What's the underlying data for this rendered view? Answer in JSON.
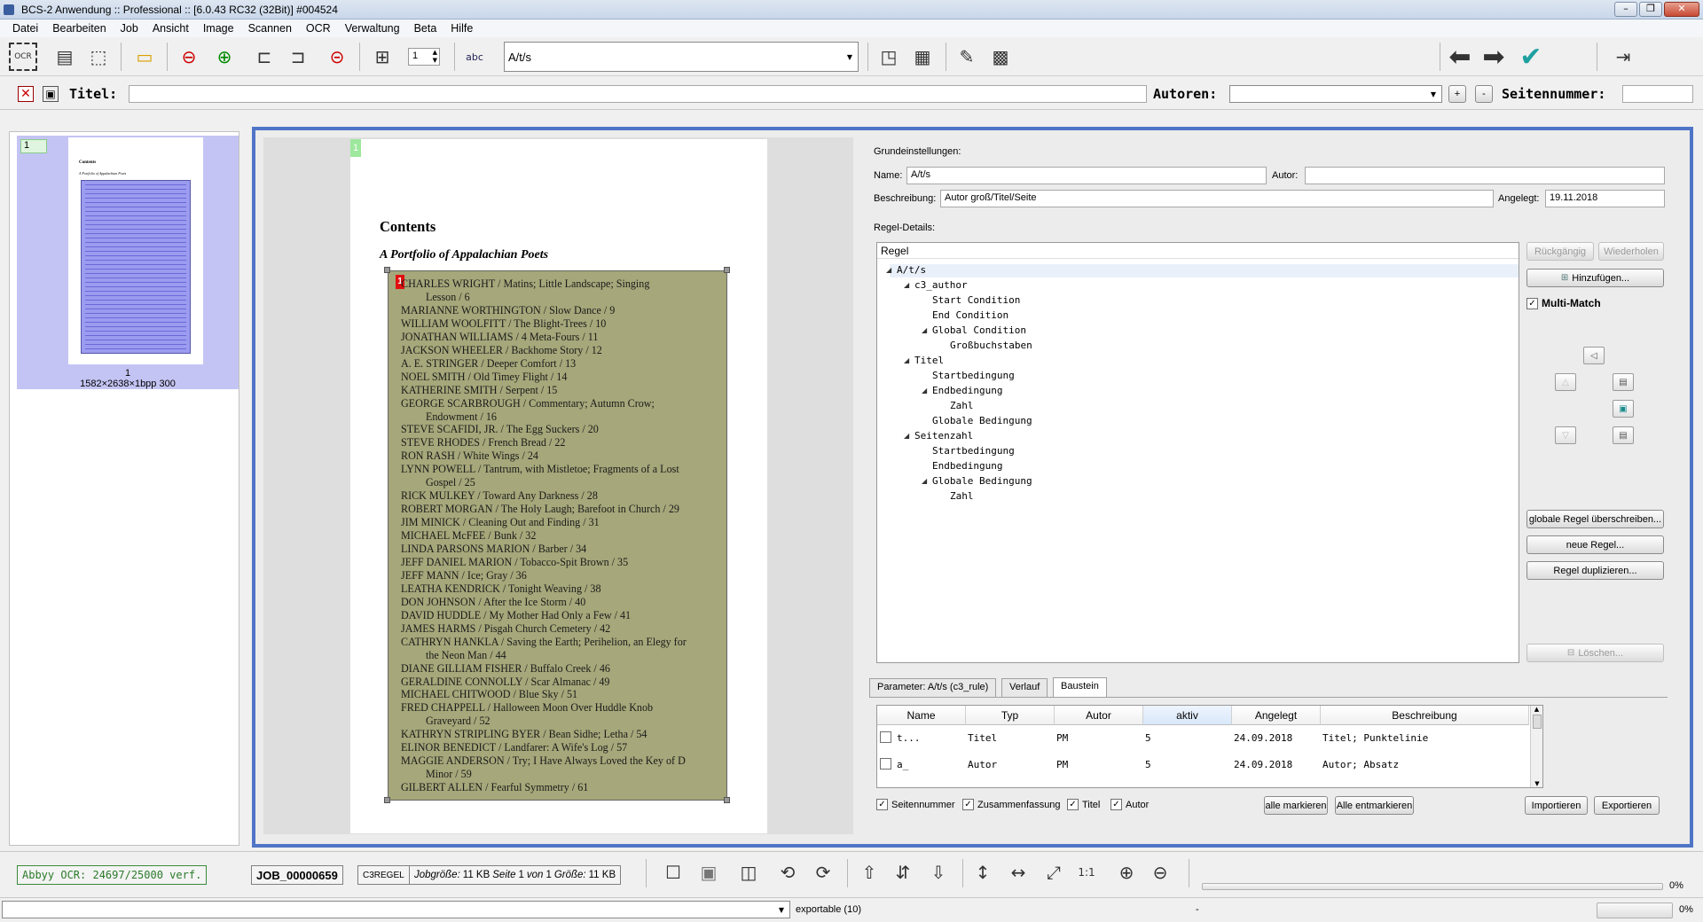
{
  "window": {
    "title": "BCS-2 Anwendung :: Professional :: [6.0.43 RC32 (32Bit)]  #004524"
  },
  "menu": [
    "Datei",
    "Bearbeiten",
    "Job",
    "Ansicht",
    "Image",
    "Scannen",
    "OCR",
    "Verwaltung",
    "Beta",
    "Hilfe"
  ],
  "toolbar": {
    "spin_value": "1",
    "rule_combo": "A/t/s",
    "ocr_label": "OCR"
  },
  "meta": {
    "titel_label": "Titel:",
    "autoren_label": "Autoren:",
    "seitennummer_label": "Seitennummer:",
    "plus": "+",
    "minus": "-"
  },
  "thumbnail": {
    "badge": "1",
    "page_no": "1",
    "info": "1582×2638×1bpp 300",
    "mini_title": "Contents",
    "mini_sub": "A Portfolio of Appalachian Poets"
  },
  "document": {
    "page_badge": "1",
    "heading": "Contents",
    "subheading": "A Portfolio of Appalachian Poets",
    "zone_badge": "1",
    "lines": [
      {
        "text": "CHARLES WRIGHT / Matins; Little Landscape; Singing",
        "indent": false
      },
      {
        "text": "Lesson / 6",
        "indent": true
      },
      {
        "text": "MARIANNE WORTHINGTON / Slow Dance / 9",
        "indent": false
      },
      {
        "text": "WILLIAM WOOLFITT / The Blight-Trees / 10",
        "indent": false
      },
      {
        "text": "JONATHAN WILLIAMS / 4 Meta-Fours / 11",
        "indent": false
      },
      {
        "text": "JACKSON WHEELER / Backhome Story / 12",
        "indent": false
      },
      {
        "text": "A. E. STRINGER / Deeper Comfort / 13",
        "indent": false
      },
      {
        "text": "NOEL SMITH / Old Timey Flight / 14",
        "indent": false
      },
      {
        "text": "KATHERINE SMITH / Serpent / 15",
        "indent": false
      },
      {
        "text": "GEORGE SCARBROUGH / Commentary; Autumn Crow;",
        "indent": false
      },
      {
        "text": "Endowment / 16",
        "indent": true
      },
      {
        "text": "STEVE SCAFIDI, JR. / The Egg Suckers / 20",
        "indent": false
      },
      {
        "text": "STEVE RHODES / French Bread / 22",
        "indent": false
      },
      {
        "text": "RON RASH / White Wings / 24",
        "indent": false
      },
      {
        "text": "LYNN POWELL / Tantrum, with Mistletoe; Fragments of a Lost",
        "indent": false
      },
      {
        "text": "Gospel / 25",
        "indent": true
      },
      {
        "text": "RICK MULKEY / Toward Any Darkness / 28",
        "indent": false
      },
      {
        "text": "ROBERT MORGAN / The Holy Laugh; Barefoot in Church / 29",
        "indent": false
      },
      {
        "text": "JIM MINICK / Cleaning Out and Finding / 31",
        "indent": false
      },
      {
        "text": "MICHAEL McFEE / Bunk / 32",
        "indent": false
      },
      {
        "text": "LINDA PARSONS MARION / Barber / 34",
        "indent": false
      },
      {
        "text": "JEFF DANIEL MARION / Tobacco-Spit Brown / 35",
        "indent": false
      },
      {
        "text": "JEFF MANN / Ice; Gray / 36",
        "indent": false
      },
      {
        "text": "LEATHA KENDRICK / Tonight Weaving / 38",
        "indent": false
      },
      {
        "text": "DON JOHNSON / After the Ice Storm / 40",
        "indent": false
      },
      {
        "text": "DAVID HUDDLE / My Mother Had Only a Few / 41",
        "indent": false
      },
      {
        "text": "JAMES HARMS / Pisgah Church Cemetery / 42",
        "indent": false
      },
      {
        "text": "CATHRYN HANKLA / Saving the Earth; Perihelion, an Elegy for",
        "indent": false
      },
      {
        "text": "the Neon Man / 44",
        "indent": true
      },
      {
        "text": "DIANE GILLIAM FISHER / Buffalo Creek / 46",
        "indent": false
      },
      {
        "text": "GERALDINE CONNOLLY / Scar Almanac / 49",
        "indent": false
      },
      {
        "text": "MICHAEL CHITWOOD / Blue Sky / 51",
        "indent": false
      },
      {
        "text": "FRED CHAPPELL / Halloween Moon Over Huddle Knob",
        "indent": false
      },
      {
        "text": "Graveyard / 52",
        "indent": true
      },
      {
        "text": "KATHRYN STRIPLING BYER / Bean Sidhe; Letha / 54",
        "indent": false
      },
      {
        "text": "ELINOR BENEDICT / Landfarer: A Wife's Log / 57",
        "indent": false
      },
      {
        "text": "MAGGIE ANDERSON / Try; I Have Always Loved the Key of D",
        "indent": false
      },
      {
        "text": "Minor / 59",
        "indent": true
      },
      {
        "text": "GILBERT ALLEN / Fearful Symmetry / 61",
        "indent": false
      }
    ]
  },
  "settings": {
    "grund_label": "Grundeinstellungen:",
    "name_label": "Name:",
    "name_value": "A/t/s",
    "autor_label": "Autor:",
    "autor_value": "",
    "beschreibung_label": "Beschreibung:",
    "beschreibung_value": "Autor groß/Titel/Seite",
    "angelegt_label": "Angelegt:",
    "angelegt_value": "19.11.2018",
    "regel_details_label": "Regel-Details:",
    "tree_header": "Regel",
    "tree": [
      {
        "label": "A/t/s",
        "level": 0,
        "expander": true
      },
      {
        "label": "c3_author",
        "level": 1,
        "expander": true
      },
      {
        "label": "Start Condition",
        "level": 2,
        "expander": false
      },
      {
        "label": "End Condition",
        "level": 2,
        "expander": false
      },
      {
        "label": "Global Condition",
        "level": 2,
        "expander": true
      },
      {
        "label": "Großbuchstaben",
        "level": 3,
        "expander": false
      },
      {
        "label": "Titel",
        "level": 1,
        "expander": true
      },
      {
        "label": "Startbedingung",
        "level": 2,
        "expander": false
      },
      {
        "label": "Endbedingung",
        "level": 2,
        "expander": true
      },
      {
        "label": "Zahl",
        "level": 3,
        "expander": false
      },
      {
        "label": "Globale Bedingung",
        "level": 2,
        "expander": false
      },
      {
        "label": "Seitenzahl",
        "level": 1,
        "expander": true
      },
      {
        "label": "Startbedingung",
        "level": 2,
        "expander": false
      },
      {
        "label": "Endbedingung",
        "level": 2,
        "expander": false
      },
      {
        "label": "Globale Bedingung",
        "level": 2,
        "expander": true
      },
      {
        "label": "Zahl",
        "level": 3,
        "expander": false
      }
    ],
    "buttons": {
      "rueckgaengig": "Rückgängig",
      "wiederholen": "Wiederholen",
      "hinzufuegen": "Hinzufügen...",
      "multi_match": "Multi-Match",
      "global_override": "globale Regel überschreiben...",
      "neue_regel": "neue Regel...",
      "regel_duplizieren": "Regel duplizieren...",
      "loeschen": "Löschen..."
    }
  },
  "tabs": [
    "Parameter: A/t/s (c3_rule)",
    "Verlauf",
    "Baustein"
  ],
  "table": {
    "columns": [
      "Name",
      "Typ",
      "Autor",
      "aktiv",
      "Angelegt",
      "Beschreibung"
    ],
    "rows": [
      {
        "name": "t...",
        "typ": "Titel",
        "autor": "PM",
        "aktiv": "5",
        "angelegt": "24.09.2018",
        "beschreibung": "Titel; Punktelinie"
      },
      {
        "name": "a_",
        "typ": "Autor",
        "autor": "PM",
        "aktiv": "5",
        "angelegt": "24.09.2018",
        "beschreibung": "Autor; Absatz"
      }
    ]
  },
  "filters": {
    "seitennummer": "Seitennummer",
    "zusammenfassung": "Zusammenfassung",
    "titel": "Titel",
    "autor": "Autor",
    "alle_markieren": "alle markieren",
    "alle_entmarkieren": "Alle entmarkieren",
    "importieren": "Importieren",
    "exportieren": "Exportieren"
  },
  "status": {
    "ocr": "Abbyy OCR: 24697/25000 verf.",
    "job": "JOB_00000659",
    "regel": "C3REGEL",
    "jobgroesse_label": "Jobgröße:",
    "jobgroesse": "11 KB",
    "seite_label": "Seite",
    "seite": "1",
    "von_label": "von",
    "von": "1",
    "groesse_label": "Größe:",
    "groesse": "11 KB",
    "progress1": "0%",
    "export": "exportable (10)",
    "dash": "-",
    "progress2": "0%"
  },
  "colors": {
    "accent": "#4f75c7",
    "zone": "#a6a77a",
    "thumb_sel": "#c4c4f4",
    "badge_green": "#9de89d",
    "badge_red": "#e01010"
  }
}
